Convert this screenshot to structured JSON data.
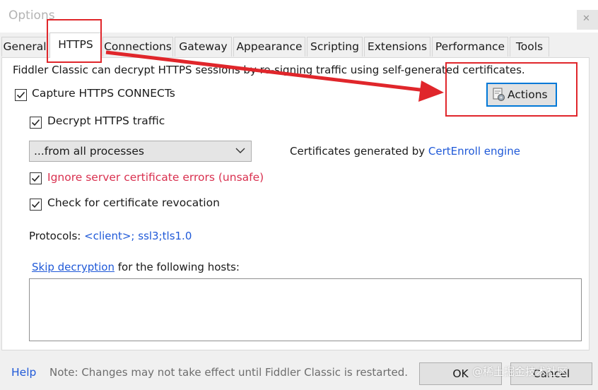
{
  "window": {
    "title": "Options"
  },
  "tabs": [
    {
      "label": "General"
    },
    {
      "label": "HTTPS"
    },
    {
      "label": "Connections"
    },
    {
      "label": "Gateway"
    },
    {
      "label": "Appearance"
    },
    {
      "label": "Scripting"
    },
    {
      "label": "Extensions"
    },
    {
      "label": "Performance"
    },
    {
      "label": "Tools"
    }
  ],
  "https": {
    "intro": "Fiddler Classic can decrypt HTTPS sessions by re-signing traffic using self-generated certificates.",
    "capture_label": "Capture HTTPS CONNECTs",
    "capture_checked": true,
    "decrypt_label": "Decrypt HTTPS traffic",
    "decrypt_checked": true,
    "process_filter": "...from all processes",
    "cert_prefix": "Certificates generated by ",
    "cert_link": "CertEnroll engine",
    "ignore_errors_label": "Ignore server certificate errors (unsafe)",
    "ignore_errors_checked": true,
    "revocation_label": "Check for certificate revocation",
    "revocation_checked": true,
    "protocols_label": "Protocols: ",
    "protocols_value": "<client>; ssl3;tls1.0",
    "skip_link": "Skip decryption",
    "skip_suffix": " for the following hosts:",
    "hosts_value": "",
    "actions_label": "Actions"
  },
  "footer": {
    "help": "Help",
    "note": "Note: Changes may not take effect until Fiddler Classic is restarted.",
    "ok": "OK",
    "cancel": "Cancel"
  },
  "watermark": "@稀土掘金技术社区",
  "colors": {
    "link": "#1f59d8",
    "warning_text": "#d9304f",
    "annotation_red": "#e0262b",
    "focus_blue": "#0078d7"
  },
  "icons": {
    "actions": "certificate-gear-icon",
    "dropdown": "chevron-down-icon",
    "check": "checkmark-icon"
  }
}
